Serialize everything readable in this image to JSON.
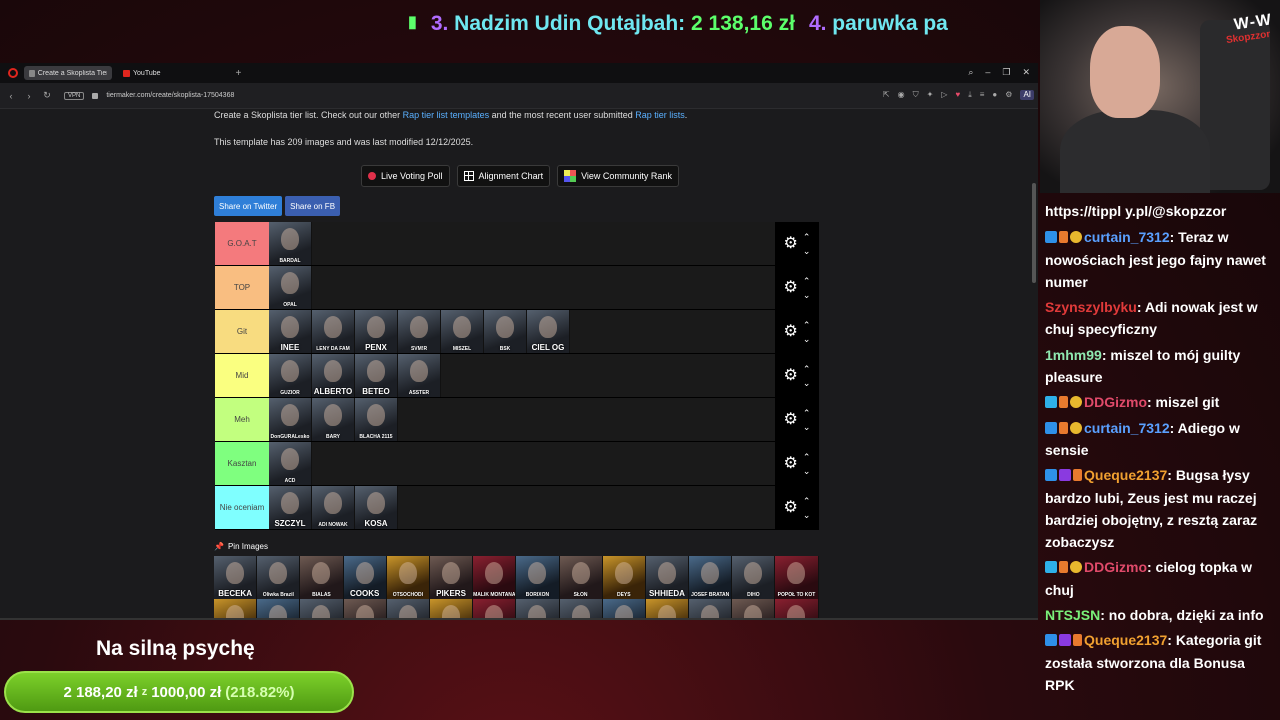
{
  "ticker": {
    "bar": "▮",
    "rank3": "3.",
    "name3": "Nadzim Udin Qutajbah:",
    "amount3": "2 138,16 zł",
    "rank4": "4.",
    "name4": "paruwka pa"
  },
  "browser": {
    "tabs": [
      {
        "label": "Create a Skoplista Tier List",
        "favicon_color": "#888888"
      },
      {
        "label": "YouTube",
        "favicon_color": "#e0261e"
      }
    ],
    "new_tab": "+",
    "url": "tiermaker.com/create/skoplista-17504368",
    "vpn": "VPN",
    "ai_label": "AI"
  },
  "page": {
    "intro_before": "Create a Skoplista tier list. Check out our other ",
    "intro_link1": "Rap tier list templates",
    "intro_middle": " and the most recent user submitted ",
    "intro_link2": "Rap tier lists",
    "intro_end": ".",
    "template_info": "This template has 209 images and was last modified 12/12/2025.",
    "btn_live": "Live Voting Poll",
    "btn_alignment": "Alignment Chart",
    "btn_community": "View Community Rank",
    "share_twitter": "Share on Twitter",
    "share_fb": "Share on FB",
    "pin_label": "Pin Images"
  },
  "tiers": [
    {
      "label": "G.O.A.T",
      "color": "#f47a7d",
      "items": [
        {
          "name": "BARDAL",
          "big": false
        }
      ]
    },
    {
      "label": "TOP",
      "color": "#f9be81",
      "items": [
        {
          "name": "OPAL",
          "big": false
        }
      ]
    },
    {
      "label": "Git",
      "color": "#f8dc80",
      "items": [
        {
          "name": "INEE",
          "big": true
        },
        {
          "name": "LENY DA FAM",
          "big": false
        },
        {
          "name": "PENX",
          "big": true
        },
        {
          "name": "SVM!R",
          "big": false
        },
        {
          "name": "MISZEL",
          "big": false
        },
        {
          "name": "BSK",
          "big": false
        },
        {
          "name": "CIEL OG",
          "big": true
        }
      ]
    },
    {
      "label": "Mid",
      "color": "#faff80",
      "items": [
        {
          "name": "GUZIOR",
          "big": false
        },
        {
          "name": "ALBERTO",
          "big": true
        },
        {
          "name": "BETEO",
          "big": true
        },
        {
          "name": "ASSTER",
          "big": false
        }
      ]
    },
    {
      "label": "Meh",
      "color": "#c2ff7f",
      "items": [
        {
          "name": "DonGURALesko",
          "big": false
        },
        {
          "name": "BARY",
          "big": false
        },
        {
          "name": "BLACHA 2115",
          "big": false
        }
      ]
    },
    {
      "label": "Kasztan",
      "color": "#7fff7f",
      "items": [
        {
          "name": "ACD",
          "big": false
        }
      ]
    },
    {
      "label": "Nie oceniam",
      "color": "#7fffff",
      "items": [
        {
          "name": "SZCZYL",
          "big": true
        },
        {
          "name": "ADI NOWAK",
          "big": false
        },
        {
          "name": "KOSA",
          "big": true
        }
      ]
    }
  ],
  "pool": [
    {
      "name": "BECEKA",
      "big": true
    },
    {
      "name": "Oliwka Brazil",
      "big": false
    },
    {
      "name": "BIALAS",
      "big": false
    },
    {
      "name": "COOKS",
      "big": true
    },
    {
      "name": "OTSOCHODI",
      "big": false
    },
    {
      "name": "PIKERS",
      "big": true
    },
    {
      "name": "MALIK MONTANA",
      "big": false
    },
    {
      "name": "BORIXON",
      "big": false
    },
    {
      "name": "SŁOŃ",
      "big": false
    },
    {
      "name": "DEYS",
      "big": false
    },
    {
      "name": "SHHIEDA",
      "big": true
    },
    {
      "name": "JOSEF BRATAN",
      "big": false
    },
    {
      "name": "DIHO",
      "big": false
    },
    {
      "name": "POPÓŁ TO KOT",
      "big": false
    },
    {
      "name": "",
      "big": false
    },
    {
      "name": "",
      "big": false
    },
    {
      "name": "",
      "big": false
    },
    {
      "name": "",
      "big": false
    },
    {
      "name": "",
      "big": false
    },
    {
      "name": "",
      "big": false
    },
    {
      "name": "",
      "big": false
    },
    {
      "name": "",
      "big": false
    },
    {
      "name": "",
      "big": false
    },
    {
      "name": "",
      "big": false
    },
    {
      "name": "",
      "big": false
    },
    {
      "name": "",
      "big": false
    },
    {
      "name": "",
      "big": false
    },
    {
      "name": "",
      "big": false
    }
  ],
  "webcam": {
    "brand": "W-W",
    "brand_sub": "Skopzzor"
  },
  "chat": {
    "link": "https://tippl y.pl/@skopzzor",
    "messages": [
      {
        "badges": [
          "b-blue",
          "b-fire",
          "b-coin"
        ],
        "user": "curtain_7312",
        "color": "#5aa0ff",
        "text": ": Teraz w nowościach jest jego fajny nawet numer"
      },
      {
        "badges": [],
        "user": "Szynszylbyku",
        "color": "#e03a3a",
        "text": ": Adi nowak jest w chuj specyficzny"
      },
      {
        "badges": [],
        "user": "1mhm99",
        "color": "#8fe8b0",
        "text": ": miszel to mój guilty pleasure"
      },
      {
        "badges": [
          "b-cyan",
          "b-fire",
          "b-coin"
        ],
        "user": "DDGizmo",
        "color": "#e04a6a",
        "text": ": miszel git"
      },
      {
        "badges": [
          "b-blue",
          "b-fire",
          "b-coin"
        ],
        "user": "curtain_7312",
        "color": "#5aa0ff",
        "text": ": Adiego w sensie"
      },
      {
        "badges": [
          "b-blue",
          "b-purple",
          "b-fire"
        ],
        "user": "Queque2137",
        "color": "#f0a030",
        "text": ": Bugsa łysy bardzo lubi, Zeus jest mu raczej bardziej obojętny, z resztą zaraz zobaczysz"
      },
      {
        "badges": [
          "b-cyan",
          "b-fire",
          "b-coin"
        ],
        "user": "DDGizmo",
        "color": "#e04a6a",
        "text": ": cielog topka w chuj"
      },
      {
        "badges": [],
        "user": "NTSJSN",
        "color": "#7af07a",
        "text": ": no dobra, dzięki za info"
      },
      {
        "badges": [
          "b-blue",
          "b-purple",
          "b-fire"
        ],
        "user": "Queque2137",
        "color": "#f0a030",
        "text": ": Kategoria git została stworzona dla Bonusa RPK"
      }
    ]
  },
  "goal": {
    "title": "Na silną psychę",
    "current": "2 188,20 zł",
    "of": "z",
    "target": "1000,00 zł",
    "pct": "(218.82%)"
  }
}
